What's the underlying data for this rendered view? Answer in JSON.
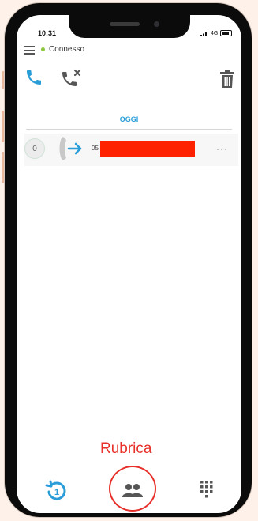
{
  "status_bar": {
    "time": "10:31",
    "network": "4G"
  },
  "header": {
    "menu_icon": "hamburger-icon",
    "connection_status": "Connesso",
    "status_color": "#8cc63f"
  },
  "toolbar": {
    "icons": [
      "phone-icon",
      "missed-call-icon",
      "trash-icon"
    ],
    "accent": "#2a9dd8"
  },
  "history": {
    "section_title": "OGGI",
    "items": [
      {
        "count": "0",
        "direction_icon": "outgoing-call-icon",
        "number_prefix": "05",
        "menu": "···"
      }
    ]
  },
  "annotation": {
    "label": "Rubrica",
    "color": "#e8302a"
  },
  "bottom_nav": {
    "items": [
      "history-icon",
      "contacts-icon",
      "dialpad-icon"
    ]
  }
}
